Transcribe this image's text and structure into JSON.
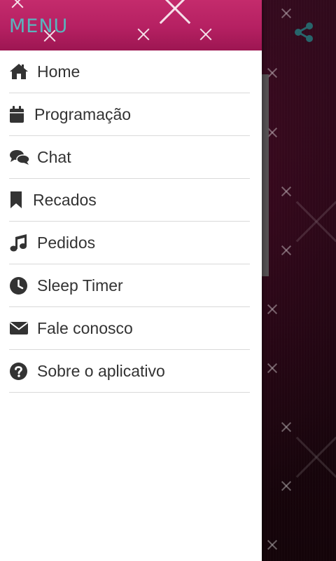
{
  "drawer": {
    "title": "MENU",
    "items": [
      {
        "label": "Home",
        "icon": "home-icon"
      },
      {
        "label": "Programação",
        "icon": "calendar-icon"
      },
      {
        "label": "Chat",
        "icon": "chat-icon"
      },
      {
        "label": "Recados",
        "icon": "bookmark-icon"
      },
      {
        "label": "Pedidos",
        "icon": "music-icon"
      },
      {
        "label": "Sleep Timer",
        "icon": "clock-icon"
      },
      {
        "label": "Fale conosco",
        "icon": "envelope-icon"
      },
      {
        "label": "Sobre o aplicativo",
        "icon": "question-circle-icon"
      }
    ]
  },
  "toolbar": {
    "share_icon": "share-icon"
  },
  "colors": {
    "header_pink": "#b52062",
    "menu_title": "#5ab4bd",
    "background": "#1a0710",
    "share_icon": "#27656b",
    "text": "#333333"
  }
}
